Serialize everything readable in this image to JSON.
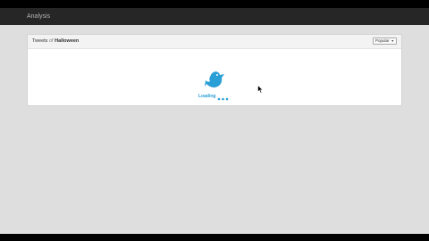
{
  "app": {
    "title": "Analysis"
  },
  "panel": {
    "title_prefix": "Tweets",
    "title_connector": "of",
    "title_topic": "Halloween",
    "sort": {
      "selected": "Popular",
      "chevron": "▼"
    }
  },
  "loader": {
    "label": "Loading",
    "icon": "twitter-bird-icon",
    "accent": "#2a9fd6"
  },
  "colors": {
    "topbar": "#262626",
    "stage": "#dedede",
    "panel": "#ffffff"
  }
}
